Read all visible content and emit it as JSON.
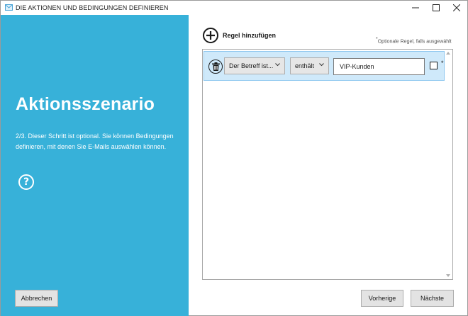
{
  "window": {
    "title": "DIE AKTIONEN UND BEDINGUNGEN DEFINIEREN"
  },
  "left": {
    "heading": "Aktionsszenario",
    "description": "2/3. Dieser Schritt ist optional. Sie können Bedingungen definieren, mit denen Sie E-Mails auswählen können.",
    "help_glyph": "?",
    "cancel_label": "Abbrechen"
  },
  "rules": {
    "add_label": "Regel hinzufügen",
    "optional_note_mark": "*",
    "optional_note": "Optionale Regel, falls ausgewählt",
    "items": [
      {
        "field": "Der Betreff ist...",
        "operator": "enthält",
        "value": "VIP-Kunden",
        "optional_checked": false,
        "optional_mark": "*"
      }
    ]
  },
  "footer": {
    "prev_label": "Vorherige",
    "next_label": "Nächste"
  },
  "colors": {
    "panel": "#37b1d9",
    "row_selected": "#cfe9fa",
    "row_border": "#8ec7ef"
  }
}
